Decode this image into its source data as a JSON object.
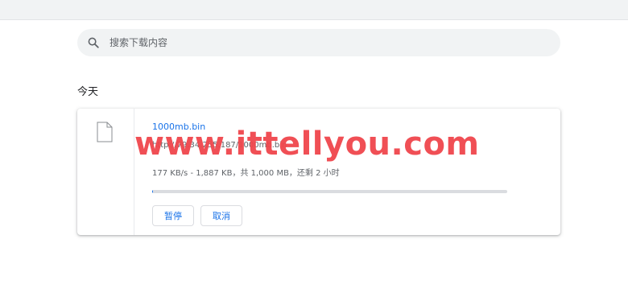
{
  "search": {
    "placeholder": "搜索下载内容",
    "icon": "search-icon"
  },
  "section": {
    "date_label": "今天"
  },
  "download": {
    "file_icon": "file-icon",
    "file_name": "1000mb.bin",
    "url": "http://79.34.255.187/1000mb.bin",
    "status": "177 KB/s - 1,887 KB，共 1,000 MB，还剩 2 小时",
    "progress_percent": 0.19,
    "pause_label": "暂停",
    "cancel_label": "取消"
  },
  "watermark": {
    "text": "www.ittellyou.com"
  },
  "colors": {
    "accent": "#1a73e8",
    "watermark": "#f0464c",
    "search_bg": "#f1f3f4"
  }
}
